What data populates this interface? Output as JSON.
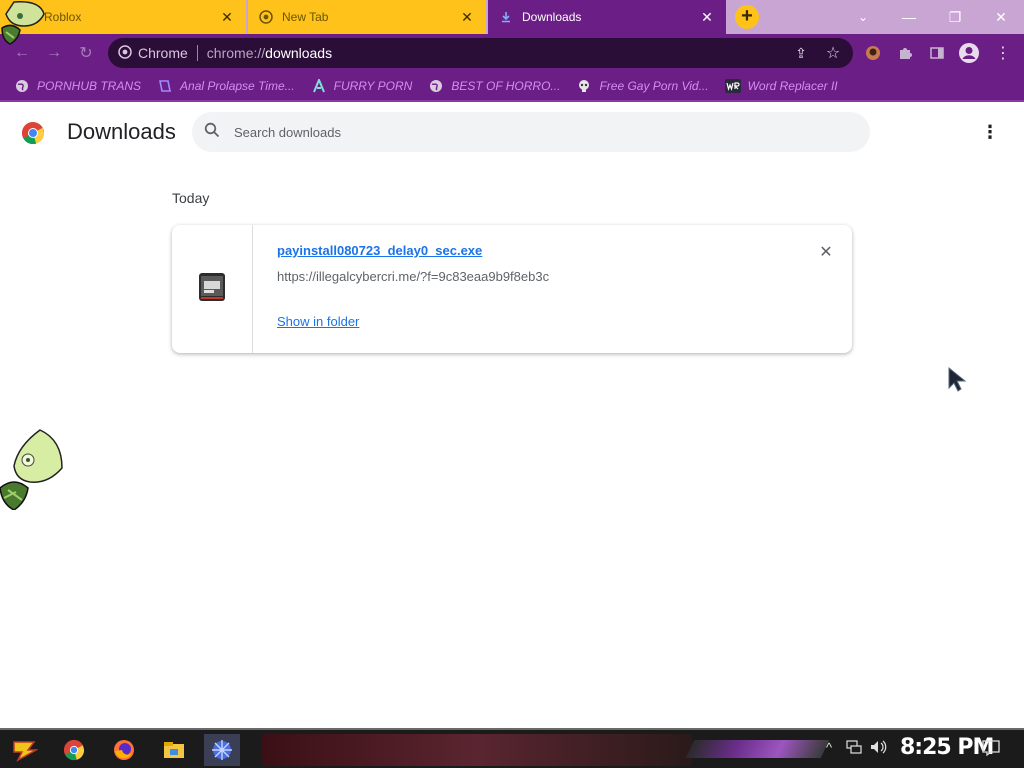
{
  "tabs": [
    {
      "title": "Roblox"
    },
    {
      "title": "New Tab"
    },
    {
      "title": "Downloads"
    }
  ],
  "omnibox": {
    "chrome_label": "Chrome",
    "scheme": "chrome://",
    "host": "downloads"
  },
  "bookmarks": [
    {
      "label": "PORNHUB TRANS",
      "icon": "globe-icon"
    },
    {
      "label": "Anal Prolapse Time...",
      "icon": "bracket-icon"
    },
    {
      "label": "FURRY PORN",
      "icon": "lambda-icon"
    },
    {
      "label": "BEST OF HORRO...",
      "icon": "globe-icon"
    },
    {
      "label": "Free Gay Porn Vid...",
      "icon": "skull-icon"
    },
    {
      "label": "Word Replacer II",
      "icon": "wr-icon"
    }
  ],
  "page": {
    "title": "Downloads",
    "search_placeholder": "Search downloads",
    "section": "Today"
  },
  "download": {
    "filename": "payinstall080723_delay0_sec.exe",
    "url": "https://illegalcybercri.me/?f=9c83eaa9b9f8eb3c",
    "show_in_folder": "Show in folder"
  },
  "taskbar": {
    "clock": "8:25 PM"
  },
  "colors": {
    "accent": "#6b1f86",
    "tab_yellow": "#ffc21a",
    "link": "#1a73e8",
    "bookmark_text": "#d58df0"
  }
}
